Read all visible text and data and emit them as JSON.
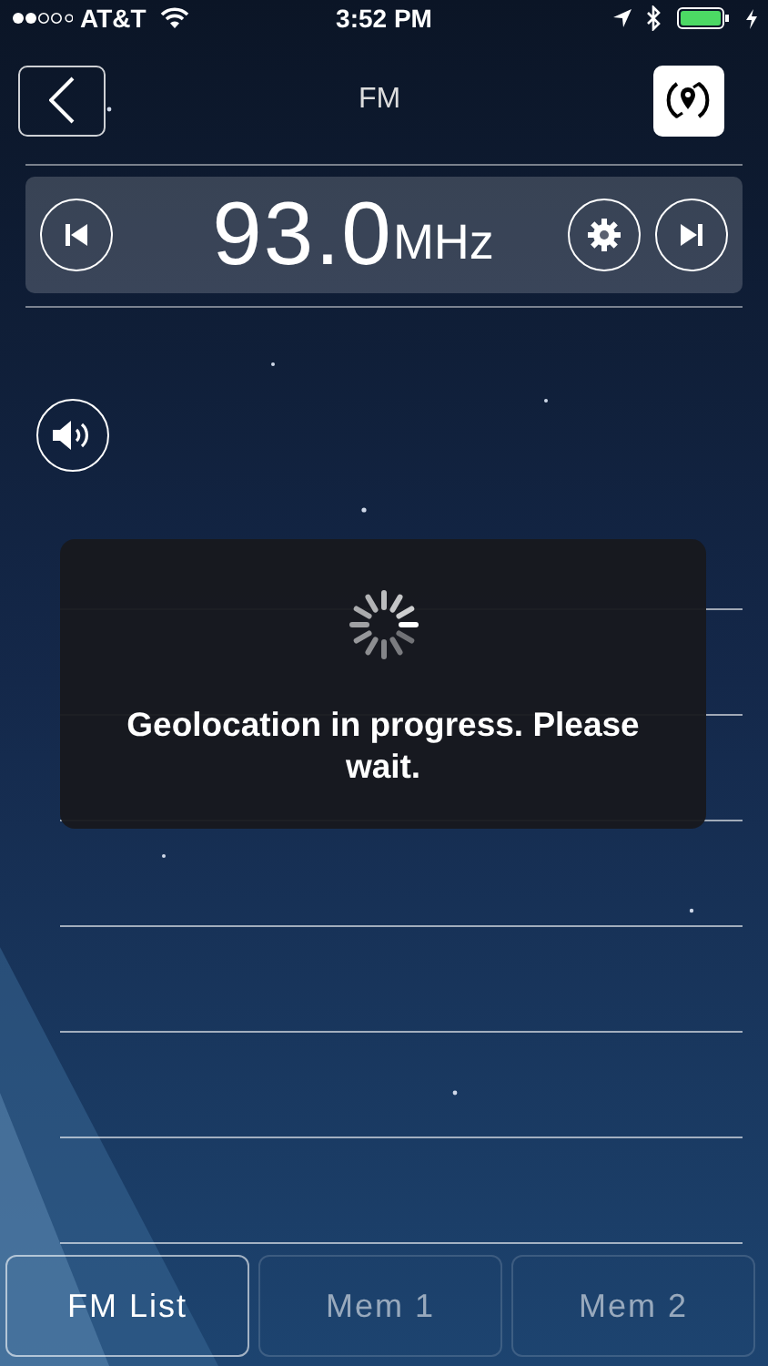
{
  "status_bar": {
    "carrier": "AT&T",
    "time": "3:52 PM"
  },
  "nav": {
    "title": "FM"
  },
  "tuner": {
    "frequency": "93.0",
    "unit": "MHz"
  },
  "dialog": {
    "message": "Geolocation in progress. Please wait."
  },
  "tabs": [
    {
      "label": "FM List",
      "selected": true
    },
    {
      "label": "Mem 1",
      "selected": false
    },
    {
      "label": "Mem 2",
      "selected": false
    }
  ]
}
